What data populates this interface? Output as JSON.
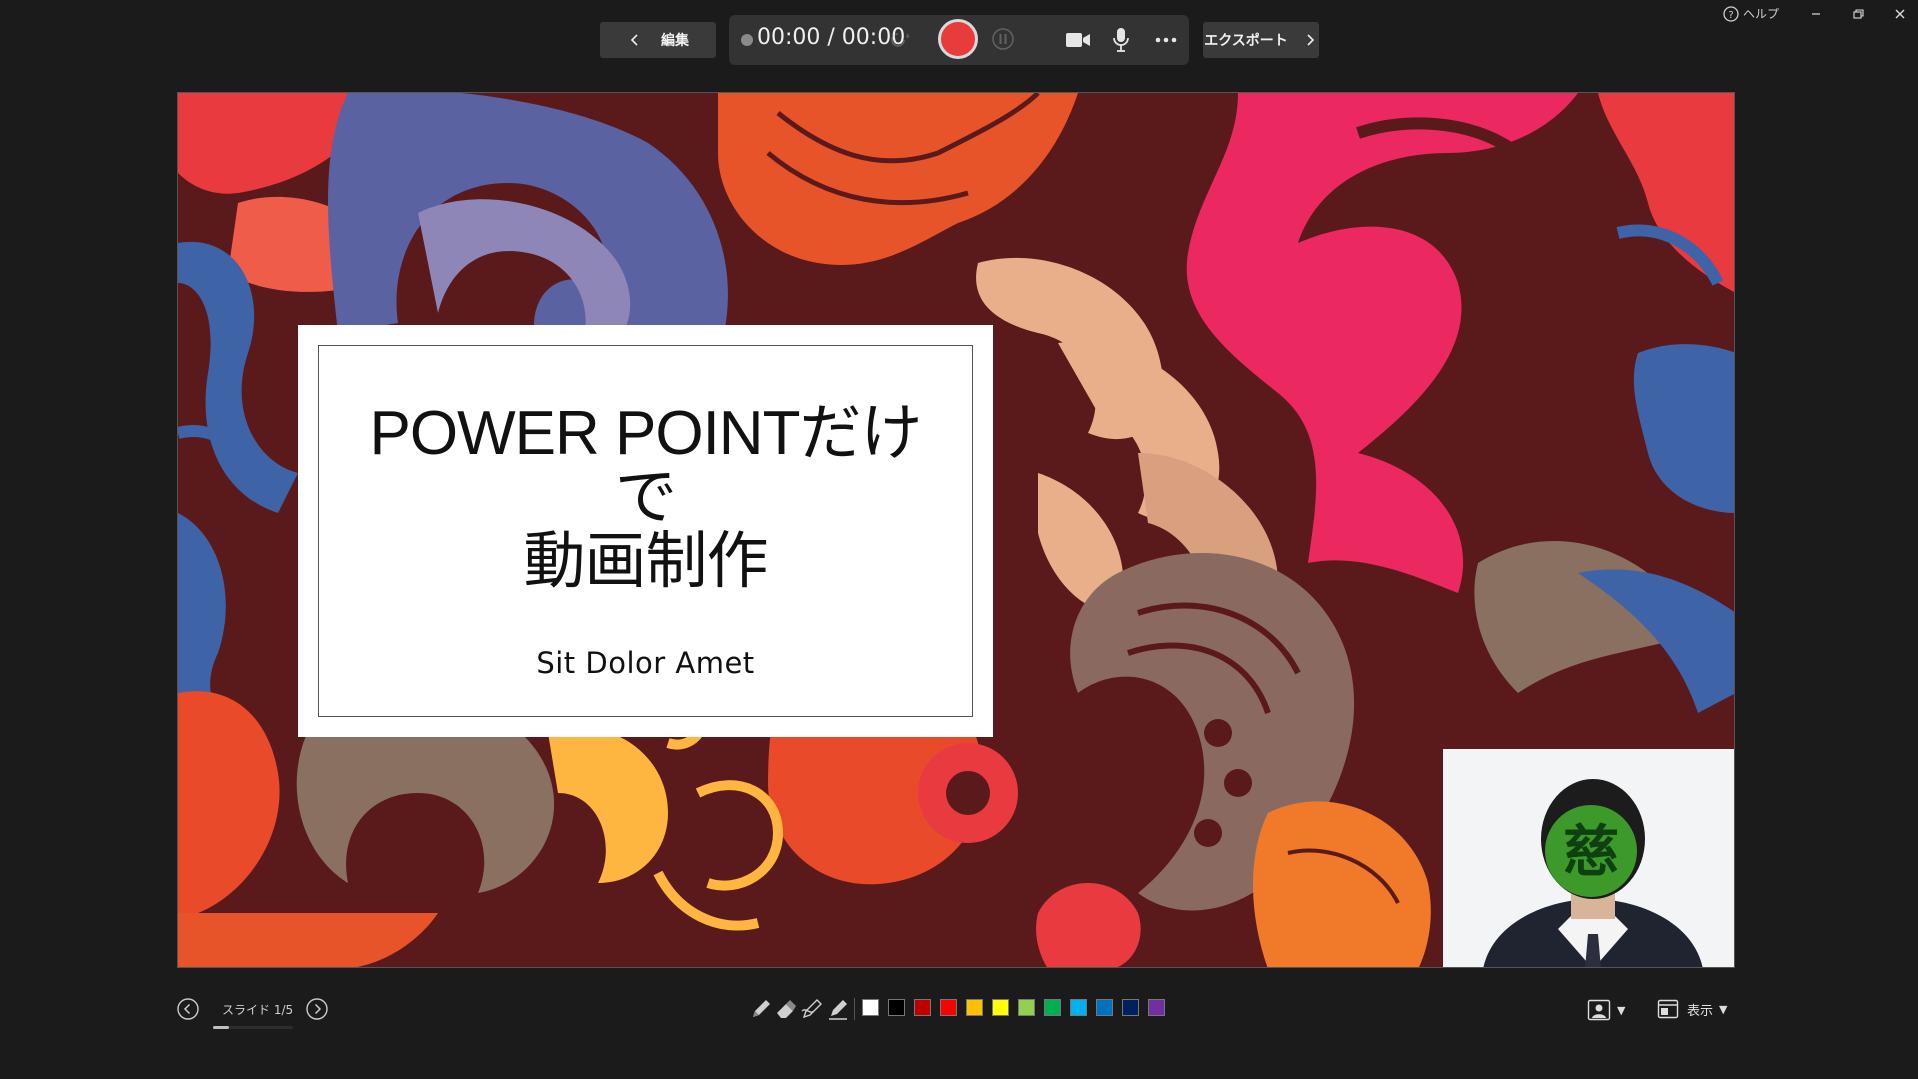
{
  "toolbar": {
    "edit_label": "編集",
    "timer": "00:00 / 00:00",
    "export_label": "エクスポート"
  },
  "window": {
    "help_label": "ヘルプ"
  },
  "slide": {
    "title_line1": "POWER POINTだけで",
    "title_line2": "動画制作",
    "subtitle": "Sit Dolor Amet"
  },
  "webcam": {
    "mosaic_glyph": "慈"
  },
  "bottom": {
    "slide_counter": "スライド 1/5",
    "progress_fraction": 0.2,
    "view_label": "表示",
    "ink_colors": [
      "#ffffff",
      "#000000",
      "#c00000",
      "#ff0000",
      "#ffc000",
      "#ffff00",
      "#92d050",
      "#00b050",
      "#00b0f0",
      "#0070c0",
      "#002060",
      "#7030a0"
    ]
  },
  "colors": {
    "record": "#e83b3b",
    "background": "#1b1b1b"
  }
}
